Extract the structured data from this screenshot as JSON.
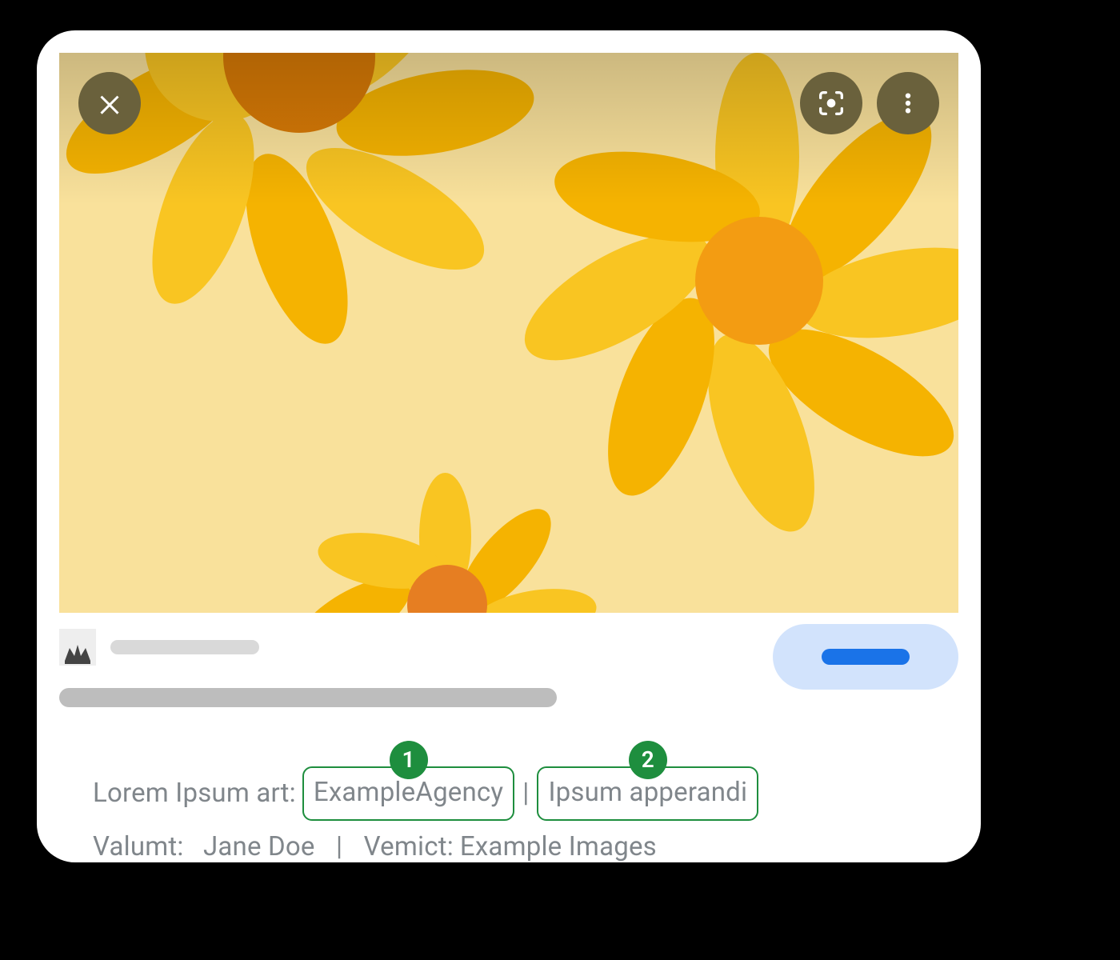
{
  "annotations": {
    "callout1": "1",
    "callout2": "2"
  },
  "credits": {
    "line1_prefix": "Lorem Ipsum art:",
    "agency": "ExampleAgency",
    "apperandi": "Ipsum apperandi",
    "line2_creator_label": "Valumt:",
    "line2_creator_name": "Jane Doe",
    "line2_credit_label": "Vemict:",
    "line2_credit_name": "Example Images",
    "separator": "|"
  }
}
